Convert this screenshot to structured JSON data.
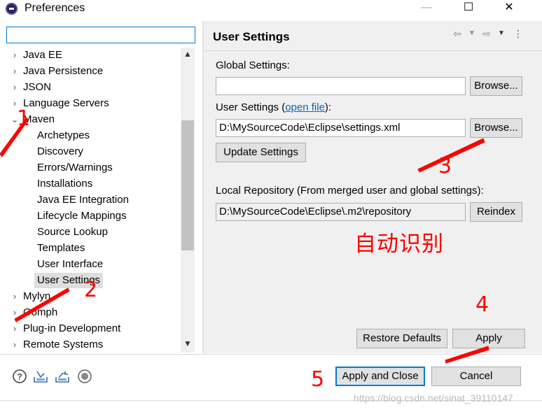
{
  "window": {
    "title": "Preferences",
    "min_glyph": "—",
    "max_glyph": "☐",
    "close_glyph": "✕"
  },
  "filter": {
    "value": "",
    "placeholder": ""
  },
  "tree": {
    "items": [
      {
        "label": "Java EE",
        "arrow": "›",
        "level": 0
      },
      {
        "label": "Java Persistence",
        "arrow": "›",
        "level": 0
      },
      {
        "label": "JSON",
        "arrow": "›",
        "level": 0
      },
      {
        "label": "Language Servers",
        "arrow": "›",
        "level": 0
      },
      {
        "label": "Maven",
        "arrow": "⌄",
        "level": 0
      },
      {
        "label": "Archetypes",
        "level": 1
      },
      {
        "label": "Discovery",
        "level": 1
      },
      {
        "label": "Errors/Warnings",
        "level": 1
      },
      {
        "label": "Installations",
        "level": 1
      },
      {
        "label": "Java EE Integration",
        "level": 1
      },
      {
        "label": "Lifecycle Mappings",
        "level": 1
      },
      {
        "label": "Source Lookup",
        "level": 1
      },
      {
        "label": "Templates",
        "level": 1
      },
      {
        "label": "User Interface",
        "level": 1
      },
      {
        "label": "User Settings",
        "level": 1,
        "selected": true
      },
      {
        "label": "Mylyn",
        "arrow": "›",
        "level": 0
      },
      {
        "label": "Oomph",
        "arrow": "›",
        "level": 0
      },
      {
        "label": "Plug-in Development",
        "arrow": "›",
        "level": 0
      },
      {
        "label": "Remote Systems",
        "arrow": "›",
        "level": 0
      }
    ]
  },
  "page": {
    "title": "User Settings",
    "global_settings_label": "Global Settings:",
    "global_settings_value": "",
    "browse_label": "Browse...",
    "user_settings_label_pre": "User Settings (",
    "user_settings_link": "open file",
    "user_settings_label_post": "):",
    "user_settings_value": "D:\\MySourceCode\\Eclipse\\settings.xml",
    "update_settings_label": "Update Settings",
    "local_repo_label": "Local Repository (From merged user and global settings):",
    "local_repo_value": "D:\\MySourceCode\\Eclipse\\.m2\\repository",
    "reindex_label": "Reindex",
    "auto_detect_note": "自动识别",
    "restore_defaults_label": "Restore Defaults",
    "apply_label": "Apply"
  },
  "footer": {
    "apply_close_label": "Apply and Close",
    "cancel_label": "Cancel",
    "icons": [
      "help-icon",
      "import-icon",
      "export-icon",
      "record-icon"
    ]
  },
  "annotations": {
    "n1": "1",
    "n2": "2",
    "n3": "3",
    "n4": "4",
    "n5": "5",
    "color": "#ff0000"
  },
  "watermark": "https://blog.csdn.net/sinat_39110147"
}
